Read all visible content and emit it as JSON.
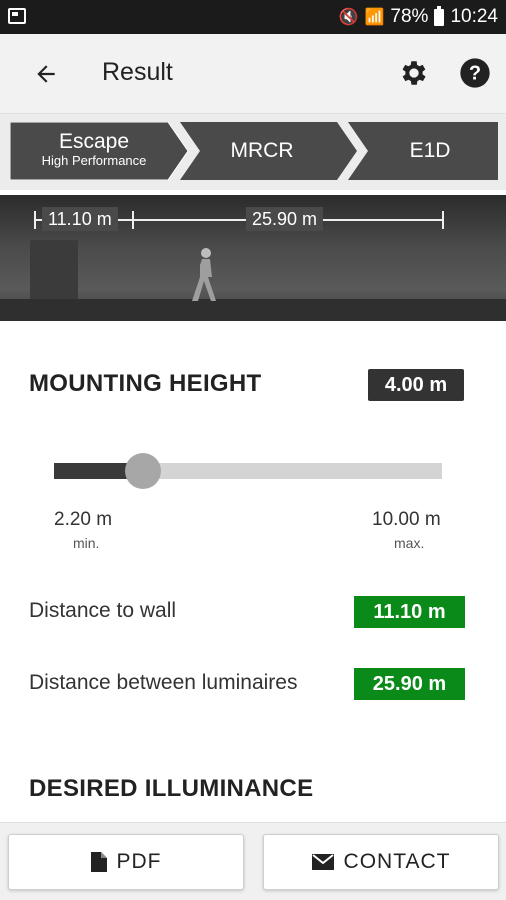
{
  "status_bar": {
    "battery": "78%",
    "time": "10:24"
  },
  "app_bar": {
    "title": "Result",
    "back_icon": "arrow-left-icon",
    "settings_icon": "gear-icon",
    "help_icon": "help-icon"
  },
  "steps": [
    {
      "label": "Escape",
      "sublabel": "High Performance"
    },
    {
      "label": "MRCR"
    },
    {
      "label": "E1D"
    }
  ],
  "scene": {
    "dist_wall": "11.10 m",
    "dist_between": "25.90 m"
  },
  "mounting_height": {
    "title": "MOUNTING HEIGHT",
    "value": "4.00 m",
    "slider_fraction": 0.23,
    "min_value": "2.20 m",
    "min_label": "min.",
    "max_value": "10.00 m",
    "max_label": "max."
  },
  "distances": {
    "wall_label": "Distance to wall",
    "wall_value": "11.10 m",
    "between_label": "Distance between luminaires",
    "between_value": "25.90 m"
  },
  "desired_illuminance": {
    "title": "DESIRED ILLUMINANCE"
  },
  "bottom": {
    "pdf_label": "PDF",
    "contact_label": "CONTACT"
  },
  "colors": {
    "green": "#0a8a18",
    "dark": "#333333",
    "step_bg": "#4a4a4a"
  }
}
